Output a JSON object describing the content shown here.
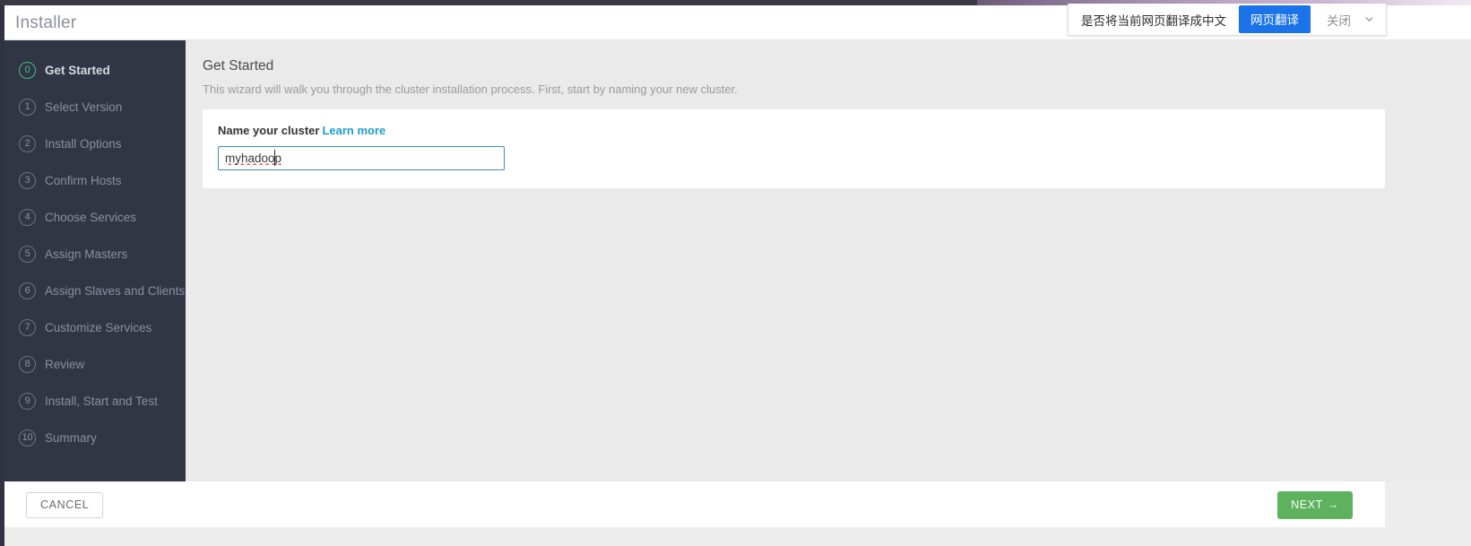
{
  "header": {
    "title": "Installer"
  },
  "translate_bar": {
    "prompt": "是否将当前网页翻译成中文",
    "translate_button": "网页翻译",
    "close_label": "关闭",
    "chevron_icon": "chevron-down-icon",
    "button_color": "#1a73e8"
  },
  "sidebar": {
    "active_color": "#3fc380",
    "background": "#323544",
    "items": [
      {
        "num": "0",
        "label": "Get Started",
        "active": true
      },
      {
        "num": "1",
        "label": "Select Version",
        "active": false
      },
      {
        "num": "2",
        "label": "Install Options",
        "active": false
      },
      {
        "num": "3",
        "label": "Confirm Hosts",
        "active": false
      },
      {
        "num": "4",
        "label": "Choose Services",
        "active": false
      },
      {
        "num": "5",
        "label": "Assign Masters",
        "active": false
      },
      {
        "num": "6",
        "label": "Assign Slaves and Clients",
        "active": false
      },
      {
        "num": "7",
        "label": "Customize Services",
        "active": false
      },
      {
        "num": "8",
        "label": "Review",
        "active": false
      },
      {
        "num": "9",
        "label": "Install, Start and Test",
        "active": false
      },
      {
        "num": "10",
        "label": "Summary",
        "active": false
      }
    ]
  },
  "main": {
    "heading": "Get Started",
    "description": "This wizard will walk you through the cluster installation process. First, start by naming your new cluster.",
    "card": {
      "field_label": "Name your cluster",
      "learn_more": "Learn more",
      "cluster_name_value": "myhadoop",
      "cluster_name_placeholder": ""
    }
  },
  "footer": {
    "cancel_label": "CANCEL",
    "next_label": "NEXT",
    "next_arrow": "→",
    "next_color": "#5cb25d"
  }
}
